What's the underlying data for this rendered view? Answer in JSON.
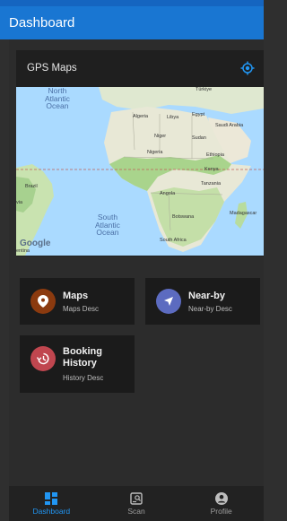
{
  "app_bar": {
    "title": "Dashboard"
  },
  "map_card": {
    "title": "GPS Maps",
    "labels": {
      "north_atlantic": [
        "North",
        "Atlantic",
        "Ocean"
      ],
      "south_atlantic": [
        "South",
        "Atlantic",
        "Ocean"
      ]
    },
    "countries": {
      "turkiye": "Türkiye",
      "algeria": "Algeria",
      "libya": "Libya",
      "egypt": "Egypt",
      "saudi": "Saudi Arabia",
      "niger": "Niger",
      "sudan": "Sudan",
      "nigeria": "Nigeria",
      "ethiopia": "Ethiopia",
      "kenya": "Kenya",
      "tanzania": "Tanzania",
      "angola": "Angola",
      "brazil": "Brazil",
      "botswana": "Botswana",
      "madagascar": "Madagascar",
      "south_africa": "South Africa",
      "via": "via",
      "entina": "entina"
    },
    "logo": "Google"
  },
  "tiles": [
    {
      "title": "Maps",
      "desc": "Maps Desc",
      "icon": "location-pin-icon",
      "color": "#8b3a0f"
    },
    {
      "title": "Near-by",
      "desc": "Near-by Desc",
      "icon": "navigation-arrow-icon",
      "color": "#5c6bc0"
    },
    {
      "title_line1": "Booking",
      "title_line2": "History",
      "desc": "History Desc",
      "icon": "history-icon",
      "color": "#c0464f"
    }
  ],
  "bottom_nav": {
    "items": [
      {
        "label": "Dashboard",
        "icon": "dashboard-icon",
        "active": true
      },
      {
        "label": "Scan",
        "icon": "scan-icon",
        "active": false
      },
      {
        "label": "Profile",
        "icon": "profile-icon",
        "active": false
      }
    ]
  },
  "colors": {
    "accent": "#1976d2",
    "active_nav": "#2196f3"
  }
}
